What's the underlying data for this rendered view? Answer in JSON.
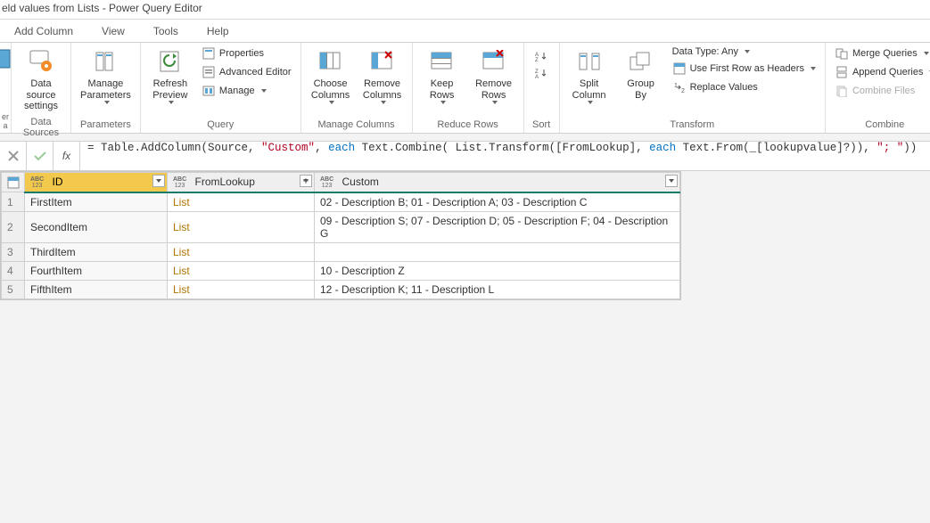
{
  "title": "eld values from Lists - Power Query Editor",
  "tabs": {
    "addColumn": "Add Column",
    "view": "View",
    "tools": "Tools",
    "help": "Help"
  },
  "ribbon": {
    "dataSources": {
      "dataSourceSettings": "Data source\nsettings",
      "label": "Data Sources"
    },
    "parameters": {
      "manageParameters": "Manage\nParameters",
      "label": "Parameters"
    },
    "query": {
      "refresh": "Refresh\nPreview",
      "properties": "Properties",
      "advanced": "Advanced Editor",
      "manage": "Manage",
      "label": "Query"
    },
    "manageColumns": {
      "choose": "Choose\nColumns",
      "remove": "Remove\nColumns",
      "label": "Manage Columns"
    },
    "reduceRows": {
      "keep": "Keep\nRows",
      "remove": "Remove\nRows",
      "label": "Reduce Rows"
    },
    "sort": {
      "label": "Sort"
    },
    "transform": {
      "split": "Split\nColumn",
      "group": "Group\nBy",
      "dataType": "Data Type: Any",
      "firstRow": "Use First Row as Headers",
      "replace": "Replace Values",
      "label": "Transform"
    },
    "combine": {
      "merge": "Merge Queries",
      "append": "Append Queries",
      "files": "Combine Files",
      "label": "Combine"
    }
  },
  "formula": {
    "prefix": "= Table.AddColumn(Source, ",
    "str": "\"Custom\"",
    "seg1": ", ",
    "each1": "each",
    "seg2": " Text.Combine( List.Transform([FromLookup], ",
    "each2": "each",
    "seg3": " Text.From(_[lookupvalue]?)), ",
    "sep": "\"; \"",
    "suffix": "))"
  },
  "columns": {
    "id": "ID",
    "fromLookup": "FromLookup",
    "custom": "Custom"
  },
  "rows": [
    {
      "n": "1",
      "id": "FirstItem",
      "from": "List",
      "custom": "02 - Description B; 01 - Description A; 03 - Description C"
    },
    {
      "n": "2",
      "id": "SecondItem",
      "from": "List",
      "custom": "09 - Description S; 07 - Description D; 05 - Description F; 04 - Description G"
    },
    {
      "n": "3",
      "id": "ThirdItem",
      "from": "List",
      "custom": ""
    },
    {
      "n": "4",
      "id": "FourthItem",
      "from": "List",
      "custom": "10 - Description Z"
    },
    {
      "n": "5",
      "id": "FifthItem",
      "from": "List",
      "custom": "12 - Description K; 11 - Description L"
    }
  ]
}
